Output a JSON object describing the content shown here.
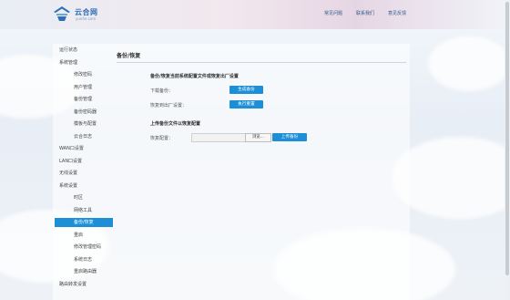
{
  "brand": {
    "name": "云合网",
    "sub": "yunhe.com"
  },
  "topnav": [
    "常见问题",
    "联系我们",
    "意见反馈"
  ],
  "sidebar": [
    {
      "label": "运行状态",
      "level": 0
    },
    {
      "label": "系统管理",
      "level": 0
    },
    {
      "label": "修改密码",
      "level": 1
    },
    {
      "label": "用户管理",
      "level": 1
    },
    {
      "label": "备份管理",
      "level": 1
    },
    {
      "label": "备份密码器",
      "level": 1
    },
    {
      "label": "模板与配置",
      "level": 1
    },
    {
      "label": "云合日志",
      "level": 1
    },
    {
      "label": "WAN口设置",
      "level": 0
    },
    {
      "label": "LAN口设置",
      "level": 0
    },
    {
      "label": "无线设置",
      "level": 0
    },
    {
      "label": "系统设置",
      "level": 0
    },
    {
      "label": "时区",
      "level": 1
    },
    {
      "label": "网络工具",
      "level": 1
    },
    {
      "label": "备份/恢复",
      "level": 1,
      "active": true
    },
    {
      "label": "重启",
      "level": 1
    },
    {
      "label": "修改管理密码",
      "level": 1
    },
    {
      "label": "系统日志",
      "level": 1
    },
    {
      "label": "重启路由器",
      "level": 1
    },
    {
      "label": "路由转发设置",
      "level": 0
    }
  ],
  "content": {
    "title": "备份/恢复",
    "section1": "备份/恢复当前系统配置文件或恢复出厂设置",
    "download_label": "下载备份：",
    "download_btn": "生成备份",
    "reset_label": "恢复到出厂设置：",
    "reset_btn": "执行重置",
    "section2": "上传备份文件以恢复配置",
    "restore_label": "恢复配置：",
    "browse_btn": "浏览...",
    "upload_btn": "上传备份"
  },
  "colors": {
    "accent": "#1c8fd6",
    "active": "#1c8fd6",
    "brand": "#2f6fb3"
  }
}
